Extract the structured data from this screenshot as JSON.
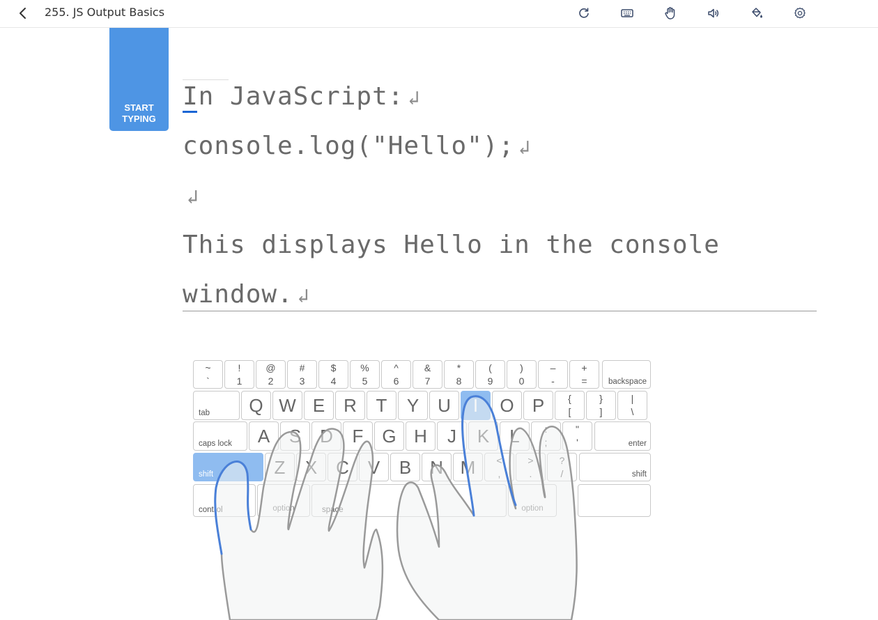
{
  "header": {
    "title": "255. JS Output Basics",
    "back_icon": "chevron-left-icon",
    "tools": [
      "refresh-icon",
      "keyboard-icon",
      "hand-icon",
      "volume-icon",
      "paint-bucket-icon",
      "settings-icon"
    ]
  },
  "start_button": {
    "line1": "START",
    "line2": "TYPING"
  },
  "lesson": {
    "lines": [
      "In JavaScript:",
      "console.log(\"Hello\");",
      "",
      "This displays Hello in the console",
      "window."
    ],
    "return_symbol": "↲"
  },
  "keyboard": {
    "row1": [
      {
        "top": "~",
        "bot": "`"
      },
      {
        "top": "!",
        "bot": "1"
      },
      {
        "top": "@",
        "bot": "2"
      },
      {
        "top": "#",
        "bot": "3"
      },
      {
        "top": "$",
        "bot": "4"
      },
      {
        "top": "%",
        "bot": "5"
      },
      {
        "top": "^",
        "bot": "6"
      },
      {
        "top": "&",
        "bot": "7"
      },
      {
        "top": "*",
        "bot": "8"
      },
      {
        "top": "(",
        "bot": "9"
      },
      {
        "top": ")",
        "bot": "0"
      },
      {
        "top": "–",
        "bot": "-"
      },
      {
        "top": "+",
        "bot": "="
      }
    ],
    "backspace": "backspace",
    "tab": "tab",
    "row2": [
      "Q",
      "W",
      "E",
      "R",
      "T",
      "Y",
      "U",
      "I",
      "O",
      "P"
    ],
    "row2_sym": [
      {
        "top": "{",
        "bot": "["
      },
      {
        "top": "}",
        "bot": "]"
      },
      {
        "top": "|",
        "bot": "\\"
      }
    ],
    "caps": "caps lock",
    "row3": [
      "A",
      "S",
      "D",
      "F",
      "G",
      "H",
      "J",
      "K",
      "L"
    ],
    "row3_sym": [
      {
        "top": ":",
        "bot": ";"
      },
      {
        "top": "\"",
        "bot": "'"
      }
    ],
    "enter": "enter",
    "shift_left": "shift",
    "row4": [
      "Z",
      "X",
      "C",
      "V",
      "B",
      "N",
      "M"
    ],
    "row4_sym": [
      {
        "top": "<",
        "bot": ","
      },
      {
        "top": ">",
        "bot": "."
      },
      {
        "top": "?",
        "bot": "/"
      }
    ],
    "shift_right": "shift",
    "control": "control",
    "option_left": "option",
    "space": "space",
    "option_right": "option",
    "highlighted": [
      "I",
      "shift-left"
    ],
    "highlight_color": "#8fbcf0"
  },
  "colors": {
    "accent": "#4e95e4",
    "cursor": "#1a66d4",
    "finger_active": "#4a80d8"
  }
}
